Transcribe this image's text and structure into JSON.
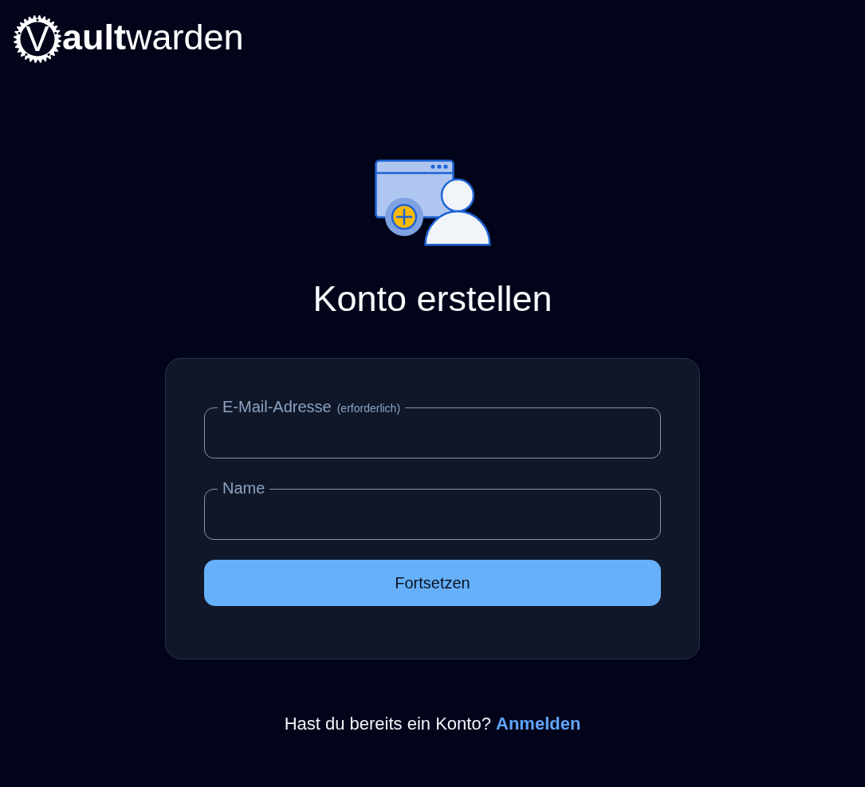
{
  "logo": {
    "mark": "V",
    "wordmark": "**ault**warden"
  },
  "heading": "Konto erstellen",
  "form": {
    "fields": [
      {
        "label": "E-Mail-Adresse",
        "hint": "(erforderlich)"
      },
      {
        "label": "Name"
      }
    ],
    "submit": "Fortsetzen"
  },
  "footer": {
    "prompt": "Hast du bereits ein Konto?",
    "link": "Anmelden"
  }
}
